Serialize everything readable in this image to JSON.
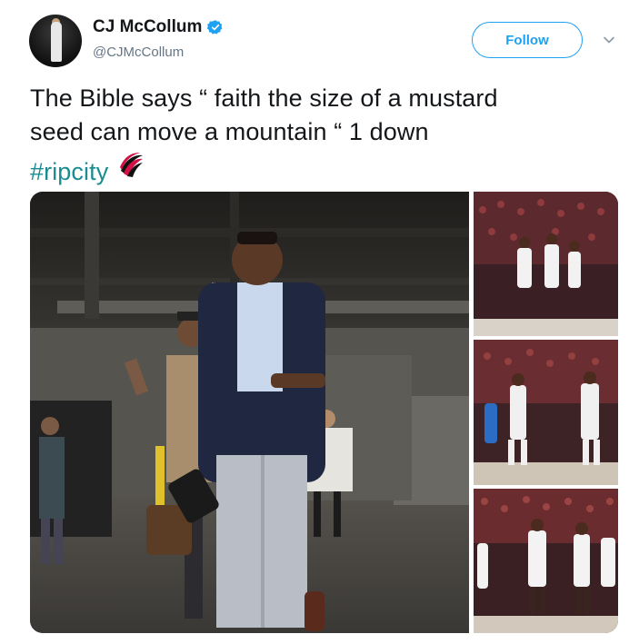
{
  "user": {
    "name": "CJ McCollum",
    "handle": "@CJMcCollum",
    "verified": true
  },
  "actions": {
    "follow_label": "Follow",
    "menu_icon": "chevron-down-icon"
  },
  "tweet": {
    "line1": "The Bible says “ faith the size of a mustard",
    "line2": "seed can move a mountain “ 1 down",
    "hashtag": "#ripcity"
  },
  "colors": {
    "accent": "#1da1f2",
    "hashtag": "#1a8d93",
    "text": "#14171a",
    "muted": "#657786"
  },
  "media": {
    "photos": [
      "main-photo",
      "court-photo-1",
      "court-photo-2",
      "court-photo-3"
    ]
  }
}
